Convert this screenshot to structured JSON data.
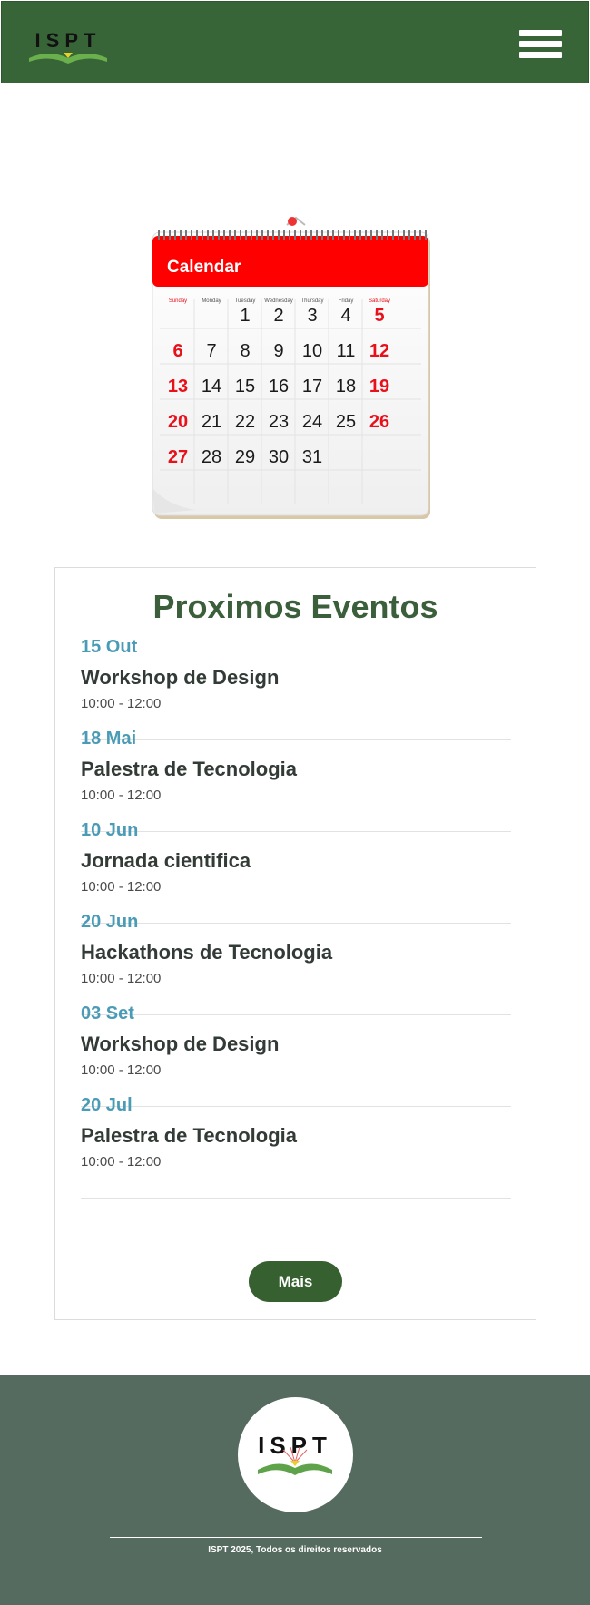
{
  "header": {
    "logo_text": "ISPT",
    "menu_icon": "hamburger-menu-icon"
  },
  "calendar_image": {
    "title": "Calendar",
    "weekdays": [
      "Sunday",
      "Monday",
      "Tuesday",
      "Wednesday",
      "Thursday",
      "Friday",
      "Saturday"
    ],
    "days": [
      [
        "",
        "",
        "1",
        "2",
        "3",
        "4",
        "5"
      ],
      [
        "6",
        "7",
        "8",
        "9",
        "10",
        "11",
        "12"
      ],
      [
        "13",
        "14",
        "15",
        "16",
        "17",
        "18",
        "19"
      ],
      [
        "20",
        "21",
        "22",
        "23",
        "24",
        "25",
        "26"
      ],
      [
        "27",
        "28",
        "29",
        "30",
        "31",
        "",
        ""
      ]
    ],
    "colors": {
      "header": "#ff0000",
      "weekend": "#e8101a",
      "weekday": "#1a1a1a"
    }
  },
  "events": {
    "title": "Proximos Eventos",
    "items": [
      {
        "date": "15 Out",
        "name": "Workshop de Design",
        "time": "10:00 - 12:00"
      },
      {
        "date": "18 Mai",
        "name": "Palestra de Tecnologia",
        "time": "10:00 - 12:00"
      },
      {
        "date": "10 Jun",
        "name": "Jornada cientifica",
        "time": "10:00 - 12:00"
      },
      {
        "date": "20 Jun",
        "name": "Hackathons de Tecnologia",
        "time": "10:00 - 12:00"
      },
      {
        "date": "03 Set",
        "name": "Workshop de Design",
        "time": "10:00 - 12:00"
      },
      {
        "date": "20 Jul",
        "name": "Palestra de Tecnologia",
        "time": "10:00 - 12:00"
      }
    ],
    "more_label": "Mais"
  },
  "footer": {
    "logo_text": "ISPT",
    "copyright": "ISPT 2025, Todos os direitos reservados"
  },
  "colors": {
    "brand_green": "#386538",
    "date_blue": "#4a9bb5",
    "footer_bg": "#556b5f"
  }
}
